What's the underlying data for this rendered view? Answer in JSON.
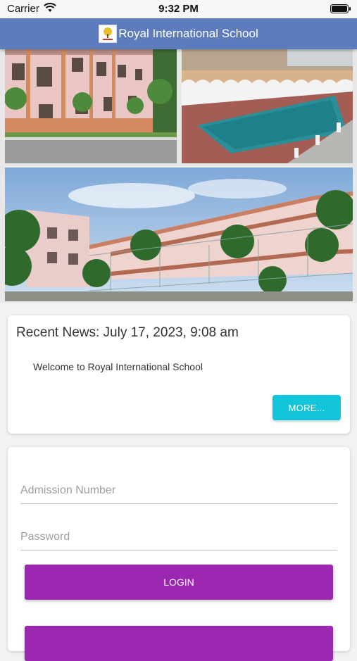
{
  "status_bar": {
    "carrier": "Carrier",
    "time": "9:32 PM",
    "icons": [
      "wifi-icon",
      "battery-icon"
    ]
  },
  "header": {
    "title": "Royal International School",
    "logo_icon": "school-logo",
    "background": "#5c7cbe"
  },
  "gallery": {
    "photos": [
      "school-building-photo",
      "swimming-pool-photo",
      "school-campus-photo"
    ]
  },
  "news": {
    "heading": "Recent News: July 17, 2023, 9:08 am",
    "items": [
      "Welcome to Royal International School"
    ],
    "more_label": "MORE...",
    "more_color": "#12c5da"
  },
  "login": {
    "admission_placeholder": "Admission Number",
    "admission_value": "",
    "password_placeholder": "Password",
    "password_value": "",
    "login_label": "LOGIN",
    "button_color": "#9c27b0"
  }
}
